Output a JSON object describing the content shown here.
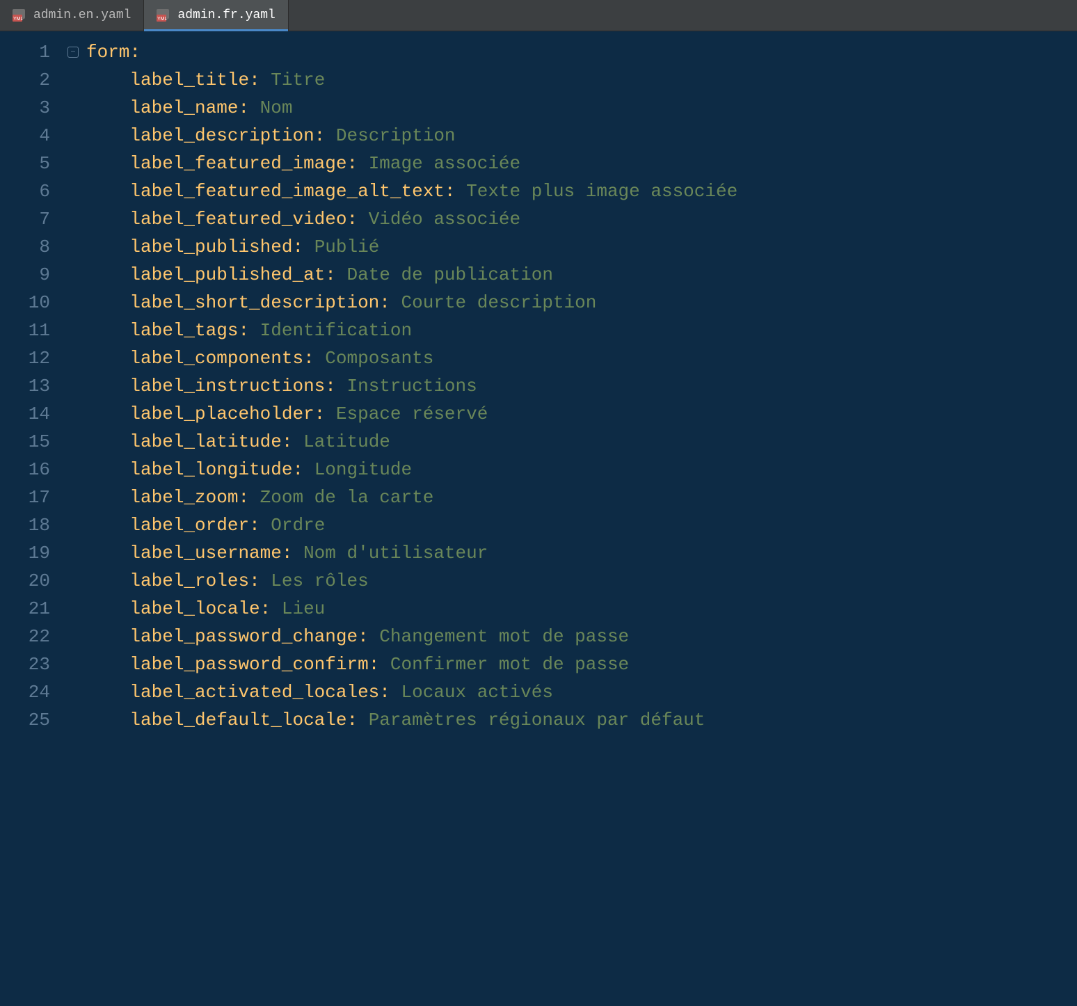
{
  "tabs": [
    {
      "label": "admin.en.yaml",
      "active": false
    },
    {
      "label": "admin.fr.yaml",
      "active": true
    }
  ],
  "code": {
    "root_key": "form",
    "lines": [
      {
        "n": 1,
        "indent": 0,
        "key": "form",
        "value": null
      },
      {
        "n": 2,
        "indent": 4,
        "key": "label_title",
        "value": "Titre"
      },
      {
        "n": 3,
        "indent": 4,
        "key": "label_name",
        "value": "Nom"
      },
      {
        "n": 4,
        "indent": 4,
        "key": "label_description",
        "value": "Description"
      },
      {
        "n": 5,
        "indent": 4,
        "key": "label_featured_image",
        "value": "Image associée"
      },
      {
        "n": 6,
        "indent": 4,
        "key": "label_featured_image_alt_text",
        "value": "Texte plus image associée"
      },
      {
        "n": 7,
        "indent": 4,
        "key": "label_featured_video",
        "value": "Vidéo associée"
      },
      {
        "n": 8,
        "indent": 4,
        "key": "label_published",
        "value": "Publié"
      },
      {
        "n": 9,
        "indent": 4,
        "key": "label_published_at",
        "value": "Date de publication"
      },
      {
        "n": 10,
        "indent": 4,
        "key": "label_short_description",
        "value": "Courte description"
      },
      {
        "n": 11,
        "indent": 4,
        "key": "label_tags",
        "value": "Identification"
      },
      {
        "n": 12,
        "indent": 4,
        "key": "label_components",
        "value": "Composants"
      },
      {
        "n": 13,
        "indent": 4,
        "key": "label_instructions",
        "value": "Instructions"
      },
      {
        "n": 14,
        "indent": 4,
        "key": "label_placeholder",
        "value": "Espace réservé"
      },
      {
        "n": 15,
        "indent": 4,
        "key": "label_latitude",
        "value": "Latitude"
      },
      {
        "n": 16,
        "indent": 4,
        "key": "label_longitude",
        "value": "Longitude"
      },
      {
        "n": 17,
        "indent": 4,
        "key": "label_zoom",
        "value": "Zoom de la carte"
      },
      {
        "n": 18,
        "indent": 4,
        "key": "label_order",
        "value": "Ordre"
      },
      {
        "n": 19,
        "indent": 4,
        "key": "label_username",
        "value": "Nom d'utilisateur"
      },
      {
        "n": 20,
        "indent": 4,
        "key": "label_roles",
        "value": "Les rôles"
      },
      {
        "n": 21,
        "indent": 4,
        "key": "label_locale",
        "value": "Lieu"
      },
      {
        "n": 22,
        "indent": 4,
        "key": "label_password_change",
        "value": "Changement mot de passe"
      },
      {
        "n": 23,
        "indent": 4,
        "key": "label_password_confirm",
        "value": "Confirmer mot de passe"
      },
      {
        "n": 24,
        "indent": 4,
        "key": "label_activated_locales",
        "value": "Locaux activés"
      },
      {
        "n": 25,
        "indent": 4,
        "key": "label_default_locale",
        "value": "Paramètres régionaux par défaut"
      }
    ]
  }
}
